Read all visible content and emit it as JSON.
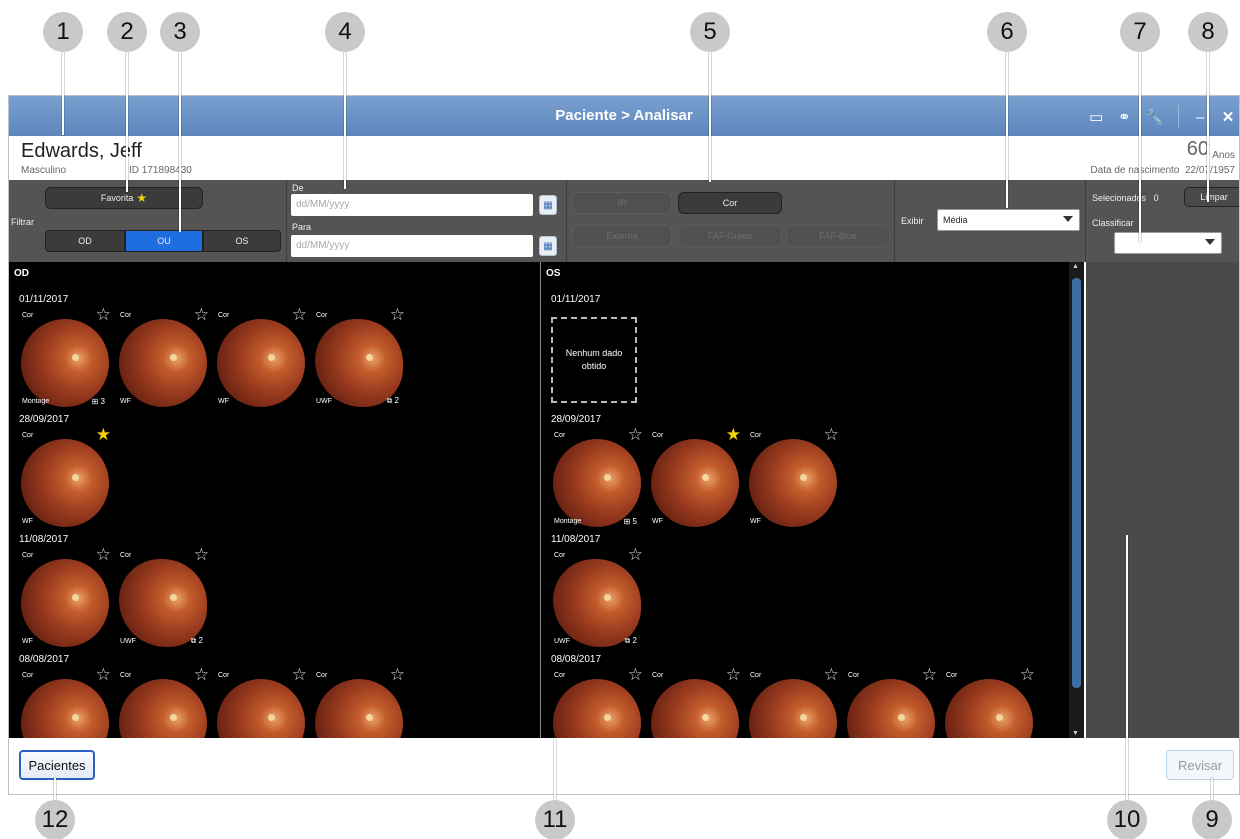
{
  "window": {
    "title": "Paciente > Analisar",
    "tool_icons": [
      "monitor-icon",
      "link-icon",
      "wrench-icon",
      "minimize-icon",
      "close-icon"
    ],
    "tool_glyphs": [
      "▭",
      "⚭",
      "🔧",
      "–",
      "✕"
    ]
  },
  "patient": {
    "name": "Edwards, Jeff",
    "sex": "Masculino",
    "id": "ID 171898430",
    "age": "60",
    "age_unit": "Anos",
    "dob_label": "Data de nascimento",
    "dob": "22/07/1957"
  },
  "toolbar": {
    "filter_label": "Filtrar",
    "favorite_label": "Favorita",
    "eye_segments": [
      "OD",
      "OU",
      "OS"
    ],
    "eye_selected": "OU",
    "from_label": "De",
    "to_label": "Para",
    "date_placeholder": "dd/MM/yyyy",
    "modalities": [
      "IR",
      "Cor",
      "Externa",
      "FAF-Green",
      "FAF-Blue"
    ],
    "active_modality": "Cor",
    "display_label": "Exibir",
    "display_value": "Média",
    "selected_label": "Selecionados",
    "selected_count": "0",
    "clear_label": "Limpar",
    "sort_label": "Classificar"
  },
  "od": {
    "header": "OD",
    "groups": [
      {
        "date": "01/11/2017",
        "thumbs": [
          {
            "label": "Cor",
            "fav": false,
            "mode": "Montage",
            "count": "3",
            "count_icon": "grid"
          },
          {
            "label": "Cor",
            "fav": false,
            "mode": "WF",
            "count": "",
            "count_icon": ""
          },
          {
            "label": "Cor",
            "fav": false,
            "mode": "WF",
            "count": "",
            "count_icon": ""
          },
          {
            "label": "Cor",
            "fav": false,
            "mode": "UWF",
            "count": "2",
            "count_icon": "stack"
          }
        ]
      },
      {
        "date": "28/09/2017",
        "thumbs": [
          {
            "label": "Cor",
            "fav": true,
            "mode": "WF",
            "count": "",
            "count_icon": ""
          }
        ]
      },
      {
        "date": "11/08/2017",
        "thumbs": [
          {
            "label": "Cor",
            "fav": false,
            "mode": "WF",
            "count": "",
            "count_icon": ""
          },
          {
            "label": "Cor",
            "fav": false,
            "mode": "UWF",
            "count": "2",
            "count_icon": "stack"
          }
        ]
      },
      {
        "date": "08/08/2017",
        "thumbs": [
          {
            "label": "Cor",
            "fav": false,
            "mode": "",
            "count": "",
            "count_icon": ""
          },
          {
            "label": "Cor",
            "fav": false,
            "mode": "",
            "count": "",
            "count_icon": ""
          },
          {
            "label": "Cor",
            "fav": false,
            "mode": "",
            "count": "",
            "count_icon": ""
          },
          {
            "label": "Cor",
            "fav": false,
            "mode": "",
            "count": "",
            "count_icon": ""
          }
        ]
      }
    ]
  },
  "os": {
    "header": "OS",
    "no_data_text": "Nenhum dado obtido",
    "groups": [
      {
        "date": "01/11/2017",
        "nodata": true,
        "thumbs": []
      },
      {
        "date": "28/09/2017",
        "thumbs": [
          {
            "label": "Cor",
            "fav": false,
            "mode": "Montage",
            "count": "5",
            "count_icon": "grid"
          },
          {
            "label": "Cor",
            "fav": true,
            "mode": "WF",
            "count": "",
            "count_icon": ""
          },
          {
            "label": "Cor",
            "fav": false,
            "mode": "WF",
            "count": "",
            "count_icon": ""
          }
        ]
      },
      {
        "date": "11/08/2017",
        "thumbs": [
          {
            "label": "Cor",
            "fav": false,
            "mode": "UWF",
            "count": "2",
            "count_icon": "stack"
          }
        ]
      },
      {
        "date": "08/08/2017",
        "thumbs": [
          {
            "label": "Cor",
            "fav": false,
            "mode": "",
            "count": "",
            "count_icon": ""
          },
          {
            "label": "Cor",
            "fav": false,
            "mode": "",
            "count": "",
            "count_icon": ""
          },
          {
            "label": "Cor",
            "fav": false,
            "mode": "",
            "count": "",
            "count_icon": ""
          },
          {
            "label": "Cor",
            "fav": false,
            "mode": "",
            "count": "",
            "count_icon": ""
          },
          {
            "label": "Cor",
            "fav": false,
            "mode": "",
            "count": "",
            "count_icon": ""
          }
        ]
      }
    ]
  },
  "bottom": {
    "patients_label": "Pacientes",
    "review_label": "Revisar"
  },
  "callouts": [
    "1",
    "2",
    "3",
    "4",
    "5",
    "6",
    "7",
    "8",
    "9",
    "10",
    "11",
    "12"
  ],
  "colors": {
    "titlebar": "#6b93c6",
    "accent_blue": "#1f6ee0",
    "favorite_star": "#f2d20a",
    "toolbar_bg": "#545454",
    "panel_bg": "#000000"
  }
}
